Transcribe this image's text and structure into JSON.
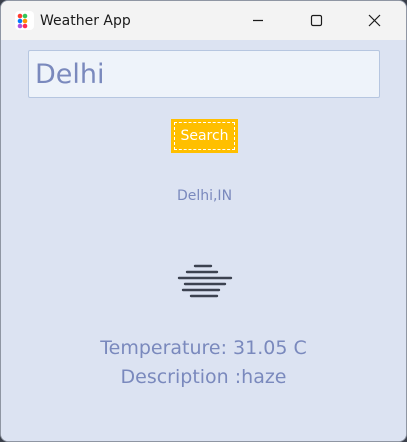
{
  "window": {
    "title": "Weather App"
  },
  "icons": {
    "app": "app-icon",
    "minimize": "minimize-icon",
    "maximize": "maximize-icon",
    "close": "close-icon",
    "weather": "haze-icon"
  },
  "search": {
    "value": "Delhi",
    "button_label": "Search"
  },
  "result": {
    "location": "Delhi,IN",
    "temperature": "Temperature: 31.05 C",
    "description": "Description :haze"
  },
  "colors": {
    "background": "#dce3f2",
    "accent": "#ffbf00",
    "text": "#7a89bd"
  }
}
